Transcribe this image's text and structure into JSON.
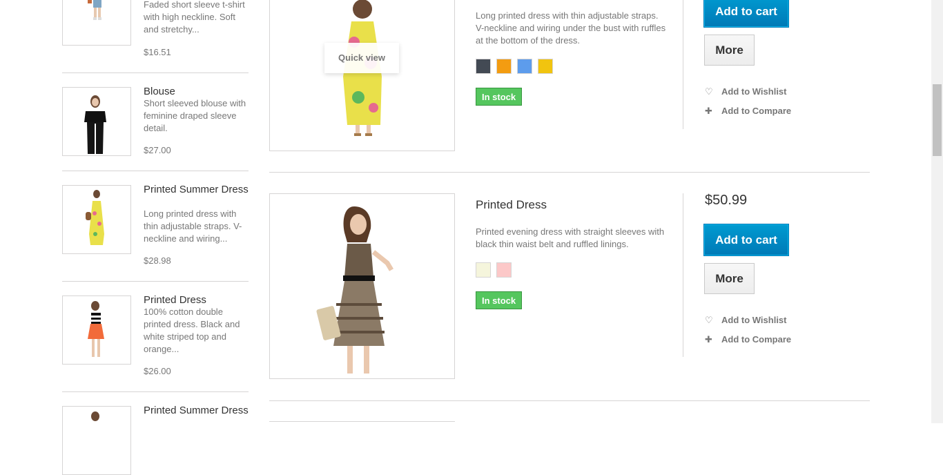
{
  "sidebar": {
    "items": [
      {
        "name": "",
        "desc": "Faded short sleeve t-shirt with high neckline. Soft and stretchy...",
        "price": "$16.51"
      },
      {
        "name": "Blouse",
        "desc": "Short sleeved blouse with feminine draped sleeve detail.",
        "price": "$27.00"
      },
      {
        "name": "Printed Summer Dress",
        "desc": "Long printed dress with thin adjustable straps. V-neckline and wiring...",
        "price": "$28.98"
      },
      {
        "name": "Printed Dress",
        "desc": "100% cotton double printed dress. Black and white striped top and orange...",
        "price": "$26.00"
      },
      {
        "name": "Printed Summer Dress",
        "desc": "",
        "price": ""
      }
    ]
  },
  "products": [
    {
      "name": "",
      "desc": "Long printed dress with thin adjustable straps. V-neckline and wiring under the bust with ruffles at the bottom of the dress.",
      "colors": [
        "#434a54",
        "#f39c11",
        "#5d9cec",
        "#f1c40f"
      ],
      "stock": "In stock",
      "price": "",
      "quick_view": "Quick view"
    },
    {
      "name": "Printed Dress",
      "desc": "Printed evening dress with straight sleeves with black thin waist belt and ruffled linings.",
      "colors": [
        "#f5f5dc",
        "#fcc8c8"
      ],
      "stock": "In stock",
      "price": "$50.99"
    }
  ],
  "actions": {
    "add_to_cart": "Add to cart",
    "more": "More",
    "wishlist": "Add to Wishlist",
    "compare": "Add to Compare",
    "wishlist_icon": "heart-icon",
    "compare_icon": "plus-icon"
  },
  "colors": {
    "cart_button": "#0079b6",
    "in_stock": "#55c65e"
  }
}
